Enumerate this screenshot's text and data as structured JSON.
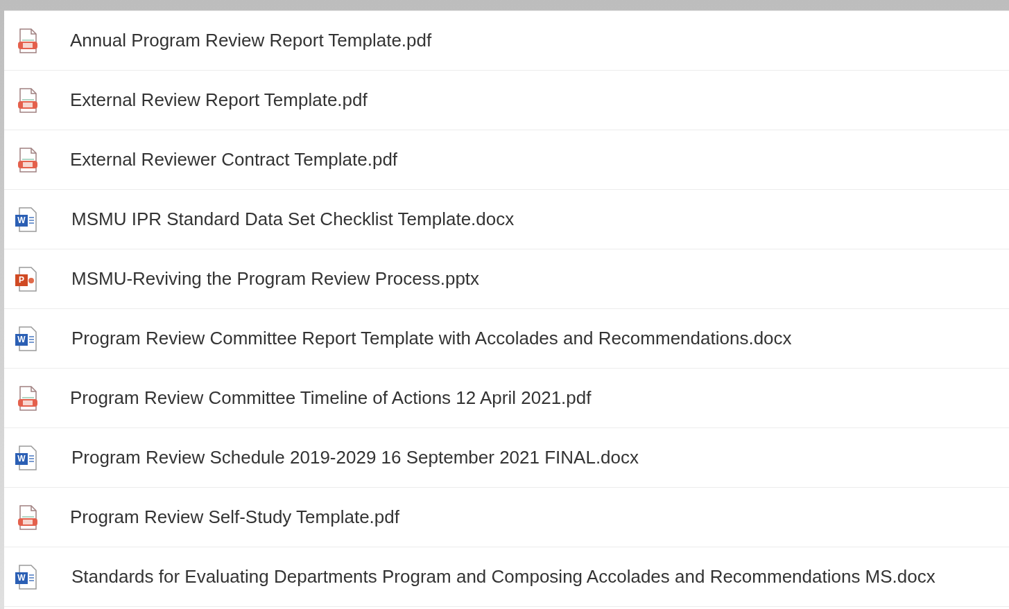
{
  "files": [
    {
      "name": "Annual Program Review Report Template.pdf",
      "kind": "pdf"
    },
    {
      "name": "External Review Report Template.pdf",
      "kind": "pdf"
    },
    {
      "name": "External Reviewer Contract Template.pdf",
      "kind": "pdf"
    },
    {
      "name": "MSMU IPR Standard Data Set Checklist Template.docx",
      "kind": "docx",
      "icon_letter": "W"
    },
    {
      "name": "MSMU-Reviving the Program Review Process.pptx",
      "kind": "pptx",
      "icon_letter": "P"
    },
    {
      "name": "Program Review Committee Report Template with Accolades and Recommendations.docx",
      "kind": "docx",
      "icon_letter": "W"
    },
    {
      "name": "Program Review Committee Timeline of Actions 12 April 2021.pdf",
      "kind": "pdf"
    },
    {
      "name": "Program Review Schedule 2019-2029 16 September 2021 FINAL.docx",
      "kind": "docx",
      "icon_letter": "W"
    },
    {
      "name": "Program Review Self-Study Template.pdf",
      "kind": "pdf"
    },
    {
      "name": "Standards for Evaluating Departments Program and Composing Accolades and Recommendations MS.docx",
      "kind": "docx",
      "icon_letter": "W"
    }
  ]
}
